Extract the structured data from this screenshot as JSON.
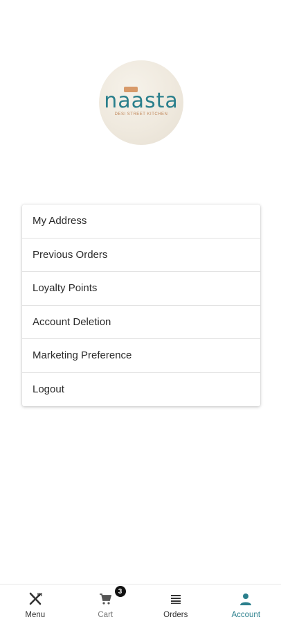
{
  "brand": {
    "name": "naasta",
    "tagline": "DESI STREET KITCHEN"
  },
  "account_menu": {
    "items": [
      {
        "label": "My Address"
      },
      {
        "label": "Previous Orders"
      },
      {
        "label": "Loyalty Points"
      },
      {
        "label": "Account Deletion"
      },
      {
        "label": "Marketing Preference"
      },
      {
        "label": "Logout"
      }
    ]
  },
  "bottom_nav": {
    "tabs": [
      {
        "label": "Menu",
        "icon": "utensils-icon"
      },
      {
        "label": "Cart",
        "icon": "cart-icon",
        "badge": "3"
      },
      {
        "label": "Orders",
        "icon": "list-icon"
      },
      {
        "label": "Account",
        "icon": "person-icon",
        "active": true
      }
    ]
  },
  "colors": {
    "accent": "#2a7f8c",
    "brand_secondary": "#c0875a",
    "badge_bg": "#111111"
  }
}
